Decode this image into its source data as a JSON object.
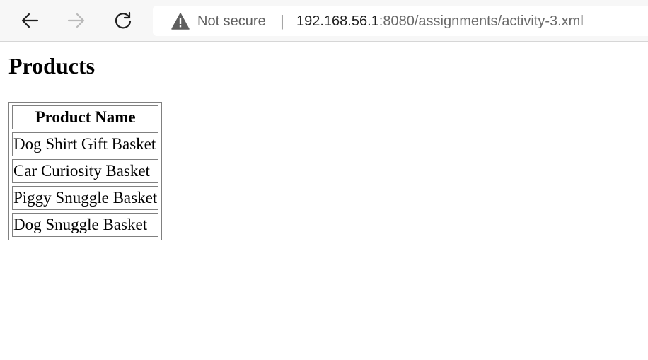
{
  "browser": {
    "back_icon": "arrow-left-icon",
    "forward_icon": "arrow-right-icon",
    "reload_icon": "reload-icon",
    "security_icon": "warning-triangle-icon",
    "security_label": "Not secure",
    "separator": "|",
    "url_host": "192.168.56.1",
    "url_rest": ":8080/assignments/activity-3.xml"
  },
  "page": {
    "title": "Products",
    "table": {
      "headers": [
        "Product Name"
      ],
      "rows": [
        [
          "Dog Shirt Gift Basket"
        ],
        [
          "Car Curiosity Basket"
        ],
        [
          "Piggy Snuggle Basket"
        ],
        [
          "Dog Snuggle Basket"
        ]
      ]
    }
  }
}
